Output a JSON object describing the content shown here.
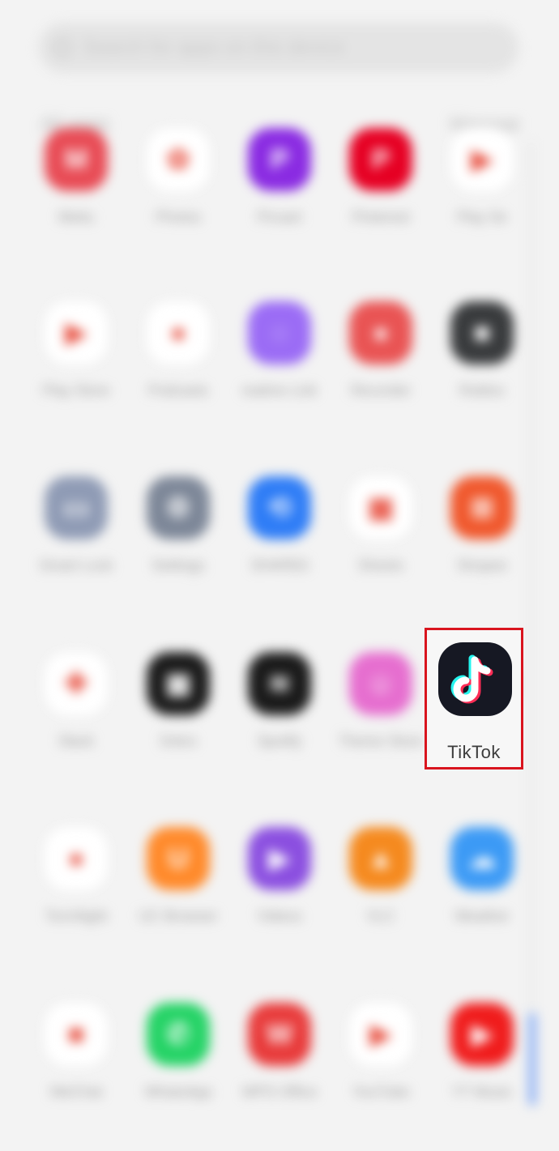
{
  "search": {
    "placeholder": "Search for apps on this device"
  },
  "header": {
    "title": "All apps",
    "manage": "Manage"
  },
  "apps": [
    {
      "name": "Meitu",
      "color": "#e84b55",
      "glyph": "M"
    },
    {
      "name": "Photos",
      "color": "#ffffff",
      "glyph": "✿"
    },
    {
      "name": "Picsart",
      "color": "#8a2be2",
      "glyph": "P"
    },
    {
      "name": "Pinterest",
      "color": "#e60023",
      "glyph": "P"
    },
    {
      "name": "Play Se",
      "color": "#ffffff",
      "glyph": "▶"
    },
    {
      "name": "Play Store",
      "color": "#ffffff",
      "glyph": "▶"
    },
    {
      "name": "Podcasts",
      "color": "#ffffff",
      "glyph": "●"
    },
    {
      "name": "realme Link",
      "color": "#9b6cf5",
      "glyph": "◌"
    },
    {
      "name": "Recorder",
      "color": "#e95454",
      "glyph": "●"
    },
    {
      "name": "Roblox",
      "color": "#393b3d",
      "glyph": "■"
    },
    {
      "name": "Smart Lock",
      "color": "#8f9bb5",
      "glyph": "▭"
    },
    {
      "name": "Settings",
      "color": "#7d8798",
      "glyph": "⚙"
    },
    {
      "name": "SHAREit",
      "color": "#2f7df6",
      "glyph": "⟲"
    },
    {
      "name": "Sheets",
      "color": "#ffffff",
      "glyph": "▦"
    },
    {
      "name": "Shopee",
      "color": "#f0582d",
      "glyph": "⊞"
    },
    {
      "name": "Slack",
      "color": "#ffffff",
      "glyph": "✚"
    },
    {
      "name": "Snkrs",
      "color": "#1a1a1a",
      "glyph": "▦"
    },
    {
      "name": "Spotify",
      "color": "#1a1a1a",
      "glyph": "≋"
    },
    {
      "name": "Theme Store",
      "color": "#e66ecf",
      "glyph": "☺"
    },
    {
      "name": "TikTok",
      "color": "#161823",
      "glyph": "♪"
    },
    {
      "name": "Torchlight",
      "color": "#ffffff",
      "glyph": "●"
    },
    {
      "name": "UC Browser",
      "color": "#ff8a2b",
      "glyph": "U"
    },
    {
      "name": "Videos",
      "color": "#8b4fe0",
      "glyph": "▶"
    },
    {
      "name": "VLC",
      "color": "#f58a1f",
      "glyph": "▲"
    },
    {
      "name": "Weather",
      "color": "#3c9af5",
      "glyph": "☁"
    },
    {
      "name": "WeChat",
      "color": "#ffffff",
      "glyph": "■"
    },
    {
      "name": "WhatsApp",
      "color": "#25d366",
      "glyph": "✆"
    },
    {
      "name": "WPS Office",
      "color": "#e83b3b",
      "glyph": "W"
    },
    {
      "name": "YouTube",
      "color": "#ffffff",
      "glyph": "▶"
    },
    {
      "name": "YT Music",
      "color": "#f01c1c",
      "glyph": "▶"
    }
  ],
  "highlighted": {
    "label": "TikTok"
  }
}
